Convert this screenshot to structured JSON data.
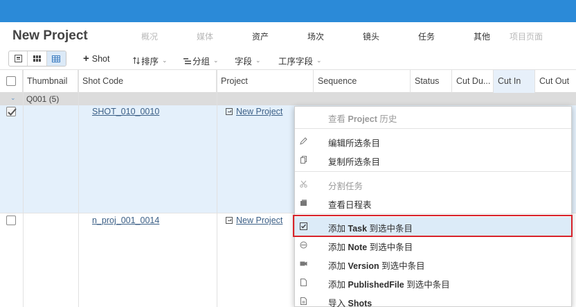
{
  "header": {
    "title": "New Project",
    "tabs": [
      {
        "label": "概况",
        "dim": true
      },
      {
        "label": "媒体",
        "dim": true
      },
      {
        "label": "资产",
        "dim": false
      },
      {
        "label": "场次",
        "dim": false
      },
      {
        "label": "镜头",
        "dim": false
      },
      {
        "label": "任务",
        "dim": false
      },
      {
        "label": "其他",
        "dim": false
      },
      {
        "label": "项目页面",
        "dim": true
      }
    ]
  },
  "toolbar": {
    "add_label": "Shot",
    "sort_label": "排序",
    "group_label": "分组",
    "fields_label": "字段",
    "pipeline_label": "工序字段"
  },
  "grid": {
    "columns": [
      "Thumbnail",
      "Shot Code",
      "Project",
      "Sequence",
      "Status",
      "Cut Du...",
      "Cut In",
      "Cut Out"
    ],
    "group_label": "Q001 (5)",
    "rows": [
      {
        "shot_code": "SHOT_010_0010",
        "project": "New Project",
        "checked": true
      },
      {
        "shot_code": "n_proj_001_0014",
        "project": "New Project",
        "checked": false
      }
    ]
  },
  "context_menu": {
    "history": {
      "pre": "查看 ",
      "bold": "Project",
      "post": " 历史"
    },
    "edit_selected": "编辑所选条目",
    "copy_selected": "复制所选条目",
    "split_task": "分割任务",
    "view_schedule": "查看日程表",
    "add_task": {
      "pre": "添加 ",
      "bold": "Task",
      "post": " 到选中条目"
    },
    "add_note": {
      "pre": "添加 ",
      "bold": "Note",
      "post": " 到选中条目"
    },
    "add_version": {
      "pre": "添加 ",
      "bold": "Version",
      "post": " 到选中条目"
    },
    "add_published": {
      "pre": "添加 ",
      "bold": "PublishedFile",
      "post": " 到选中条目"
    },
    "import_shots": {
      "pre": "导入 ",
      "bold": "Shots",
      "post": ""
    }
  },
  "colors": {
    "topbar": "#2b8ad8",
    "selected_row": "#e4f0fb",
    "highlight_box": "#d8232a"
  }
}
